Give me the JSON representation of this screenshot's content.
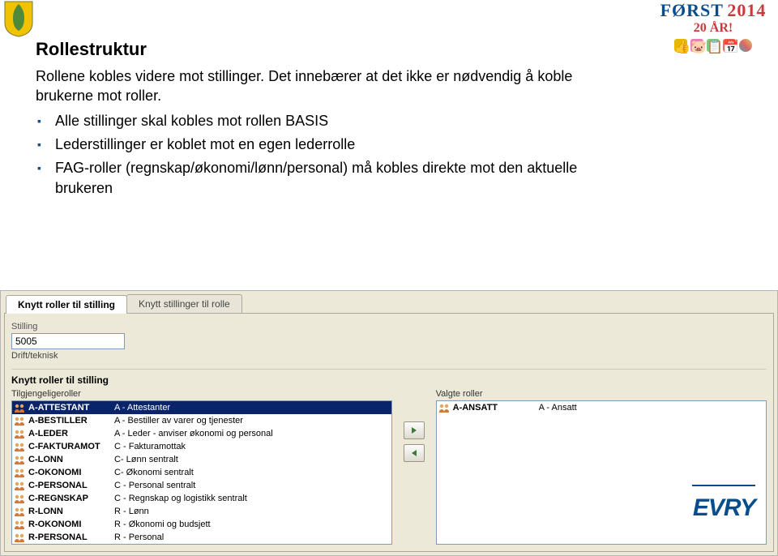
{
  "header": {
    "forst_label": "FØRST",
    "forst_year": "2014",
    "forst_sub": "20 ÅR!"
  },
  "content": {
    "title": "Rollestruktur",
    "intro": "Rollene kobles videre mot stillinger. Det innebærer at det ikke er nødvendig å koble brukerne mot roller.",
    "bullets": [
      "Alle stillinger skal kobles mot rollen BASIS",
      "Lederstillinger er koblet mot en egen lederrolle",
      "FAG-roller (regnskap/økonomi/lønn/personal) må kobles direkte mot den aktuelle brukeren"
    ]
  },
  "app": {
    "tabs": {
      "active": "Knytt roller til stilling",
      "inactive": "Knytt stillinger til rolle"
    },
    "stilling_label": "Stilling",
    "stilling_value": "5005",
    "stilling_sub": "Drift/teknisk",
    "section_label": "Knytt roller til stilling",
    "available_label": "Tilgjengeligeroller",
    "selected_label": "Valgte roller",
    "available_roles": [
      {
        "code": "A-ATTESTANT",
        "desc": "A - Attestanter",
        "selected": true
      },
      {
        "code": "A-BESTILLER",
        "desc": "A - Bestiller av varer og tjenester",
        "selected": false
      },
      {
        "code": "A-LEDER",
        "desc": "A - Leder - anviser økonomi og personal",
        "selected": false
      },
      {
        "code": "C-FAKTURAMOT",
        "desc": "C - Fakturamottak",
        "selected": false
      },
      {
        "code": "C-LONN",
        "desc": "C- Lønn sentralt",
        "selected": false
      },
      {
        "code": "C-OKONOMI",
        "desc": "C- Økonomi sentralt",
        "selected": false
      },
      {
        "code": "C-PERSONAL",
        "desc": "C - Personal sentralt",
        "selected": false
      },
      {
        "code": "C-REGNSKAP",
        "desc": "C - Regnskap og logistikk sentralt",
        "selected": false
      },
      {
        "code": "R-LONN",
        "desc": "R - Lønn",
        "selected": false
      },
      {
        "code": "R-OKONOMI",
        "desc": "R - Økonomi og budsjett",
        "selected": false
      },
      {
        "code": "R-PERSONAL",
        "desc": "R - Personal",
        "selected": false
      }
    ],
    "selected_roles": [
      {
        "code": "A-ANSATT",
        "desc": "A - Ansatt"
      }
    ]
  },
  "footer": {
    "brand": "EVRY"
  }
}
